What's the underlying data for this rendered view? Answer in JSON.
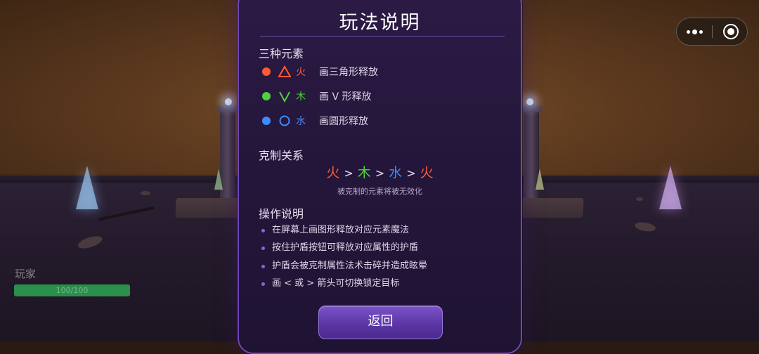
{
  "hud": {
    "player_label": "玩家",
    "hp_text": "100/100",
    "hp_fraction": 1.0
  },
  "capsule": {
    "more_icon": "more-dots-icon",
    "close_icon": "target-close-icon"
  },
  "dialog": {
    "title": "玩法说明",
    "elements_section": {
      "title": "三种元素",
      "items": [
        {
          "name": "火",
          "desc": "画三角形释放",
          "color": "#ff5a36",
          "shape": "triangle-icon"
        },
        {
          "name": "木",
          "desc": "画 V 形释放",
          "color": "#4fd13a",
          "shape": "v-shape-icon"
        },
        {
          "name": "水",
          "desc": "画圆形释放",
          "color": "#3c8dff",
          "shape": "circle-icon"
        }
      ]
    },
    "counter_section": {
      "title": "克制关系",
      "chain": [
        {
          "text": "火",
          "color": "#ff5a36"
        },
        {
          "text": "木",
          "color": "#4fd13a"
        },
        {
          "text": "水",
          "color": "#3c8dff"
        },
        {
          "text": "火",
          "color": "#ff5a36"
        }
      ],
      "separator": ">",
      "note": "被克制的元素将被无效化"
    },
    "controls_section": {
      "title": "操作说明",
      "items": [
        "在屏幕上画图形释放对应元素魔法",
        "按住护盾按钮可释放对应属性的护盾",
        "护盾会被克制属性法术击碎并造成眩晕",
        "画 < 或 > 箭头可切换锁定目标"
      ]
    },
    "back_label": "返回"
  },
  "colors": {
    "dialog_border": "#6f49b8",
    "bullet": "#8d63d6",
    "button": "#5c36a6"
  }
}
